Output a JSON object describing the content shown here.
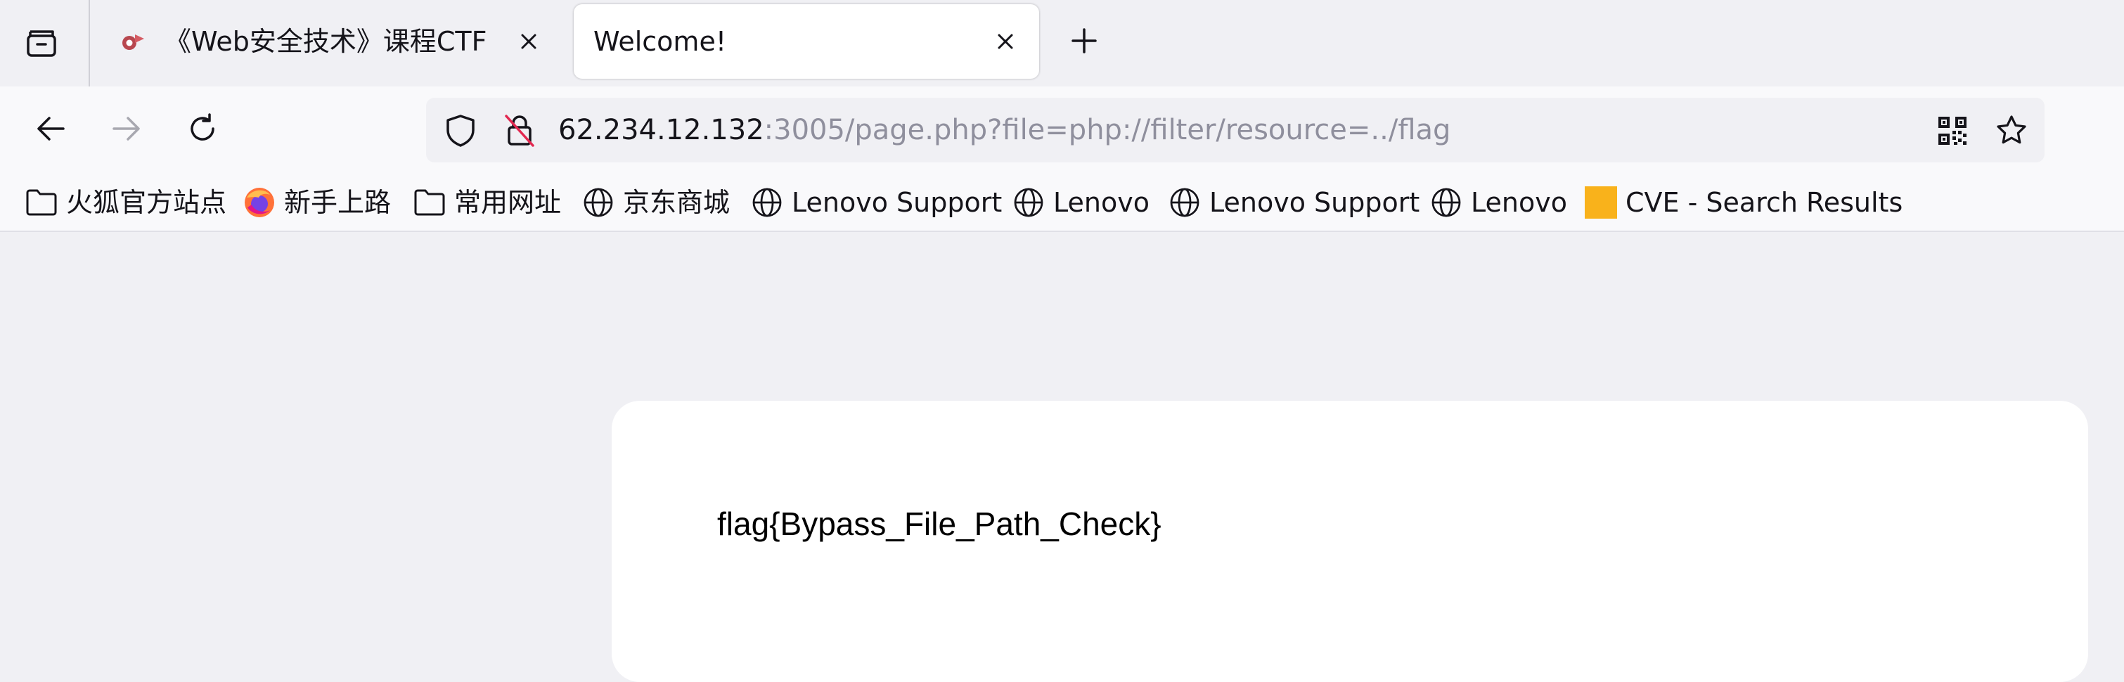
{
  "tabs": [
    {
      "title": "《Web安全技术》课程CTF",
      "favicon": "ctf-favicon",
      "active": false
    },
    {
      "title": "Welcome!",
      "active": true
    }
  ],
  "toolbar": {
    "tab_overview_icon": "tab-overview-icon",
    "new_tab_icon": "plus-icon",
    "back_icon": "arrow-left-icon",
    "forward_icon": "arrow-right-icon",
    "reload_icon": "reload-icon"
  },
  "urlbar": {
    "host": "62.234.12.132",
    "path": ":3005/page.php?file=php://filter/resource=../flag",
    "tracking_icon": "shield-icon",
    "security_icon": "insecure-lock-icon",
    "qr_icon": "qr-code-icon",
    "bookmark_icon": "star-icon"
  },
  "bookmarks": [
    {
      "label": "火狐官方站点",
      "icon": "folder-icon"
    },
    {
      "label": "新手上路",
      "icon": "firefox-icon"
    },
    {
      "label": "常用网址",
      "icon": "folder-icon"
    },
    {
      "label": "京东商城",
      "icon": "globe-icon"
    },
    {
      "label": "Lenovo Support",
      "icon": "globe-icon"
    },
    {
      "label": "Lenovo",
      "icon": "globe-icon"
    },
    {
      "label": "Lenovo Support",
      "icon": "globe-icon"
    },
    {
      "label": "Lenovo",
      "icon": "globe-icon"
    },
    {
      "label": "CVE - Search Results",
      "icon": "cve-favicon"
    }
  ],
  "page": {
    "content": "flag{Bypass_File_Path_Check}"
  },
  "colors": {
    "accent": "#f9b21b",
    "chrome": "#f0f0f4",
    "toolbar": "#f9f9fb",
    "text": "#15141a",
    "muted_text": "#8f8f9d"
  }
}
